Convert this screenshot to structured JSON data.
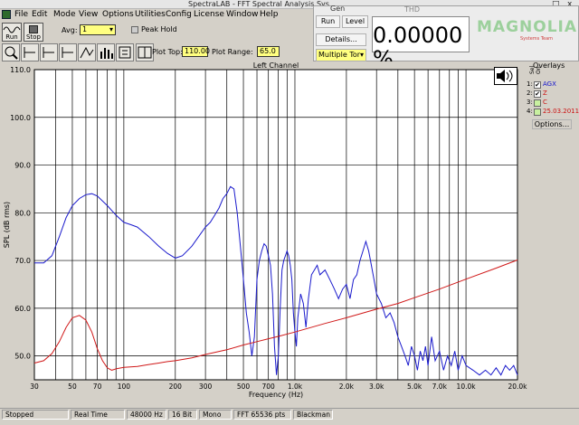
{
  "window": {
    "title": "SpectraLAB - FFT Spectral Analysis Sys",
    "controls": {
      "minimize": "_",
      "maximize": "□",
      "close": "x"
    }
  },
  "menu": [
    "File",
    "Edit",
    "Mode",
    "View",
    "Options",
    "Utilities",
    "Config",
    "License",
    "Window",
    "Help"
  ],
  "toolbar": {
    "run_label": "Run",
    "stop_label": "Stop",
    "avg_label": "Avg:",
    "avg_value": "1",
    "peak_hold_label": "Peak Hold",
    "plot_top_label": "Plot Top:",
    "plot_top_value": "110.00",
    "plot_range_label": "Plot Range:",
    "plot_range_value": "65.0"
  },
  "thd_panel": {
    "tab_label": "Gen",
    "title": "THD",
    "run_label": "Run",
    "level_label": "Level",
    "details_label": "Details...",
    "mode_value": "Multiple Tor",
    "reading": "0.00000 %",
    "logo": "MAGNOLIA",
    "logo_sub": "Systems Team"
  },
  "overlays": {
    "title": "Overlays",
    "col_sel": "Sel",
    "col_on": "On",
    "items": [
      {
        "index": "1:",
        "name": "AGX",
        "color": "#1010cc",
        "checked": true
      },
      {
        "index": "2:",
        "name": "Z",
        "color": "#cc1010",
        "checked": true
      },
      {
        "index": "3:",
        "name": "C",
        "color": "#cc1010",
        "checked": false
      },
      {
        "index": "4:",
        "name": "25.03.2011",
        "color": "#cc1010",
        "checked": false
      }
    ],
    "options_label": "Options..."
  },
  "chart_data": {
    "type": "line",
    "title": "Left Channel",
    "xlabel": "Frequency (Hz)",
    "ylabel": "SPL (dB rms)",
    "x_scale": "log",
    "xlim": [
      30,
      20000
    ],
    "ylim": [
      45,
      110
    ],
    "y_ticks": [
      50.0,
      60.0,
      70.0,
      80.0,
      90.0,
      100.0,
      110.0
    ],
    "x_ticks": [
      {
        "v": 30,
        "label": "30"
      },
      {
        "v": 50,
        "label": "50"
      },
      {
        "v": 70,
        "label": "70"
      },
      {
        "v": 100,
        "label": "100"
      },
      {
        "v": 200,
        "label": "200"
      },
      {
        "v": 300,
        "label": "300"
      },
      {
        "v": 500,
        "label": "500"
      },
      {
        "v": 700,
        "label": "700"
      },
      {
        "v": 1000,
        "label": "1.0k"
      },
      {
        "v": 2000,
        "label": "2.0k"
      },
      {
        "v": 3000,
        "label": "3.0k"
      },
      {
        "v": 5000,
        "label": "5.0k"
      },
      {
        "v": 7000,
        "label": "7.0k"
      },
      {
        "v": 10000,
        "label": "10.0k"
      },
      {
        "v": 20000,
        "label": "20.0k"
      }
    ],
    "grid": true,
    "series": [
      {
        "name": "AGX",
        "color": "#1a1acc",
        "points": [
          [
            30,
            69.5
          ],
          [
            34,
            69.5
          ],
          [
            38,
            71
          ],
          [
            42,
            75
          ],
          [
            46,
            79
          ],
          [
            50,
            81.5
          ],
          [
            55,
            83
          ],
          [
            60,
            83.8
          ],
          [
            65,
            84
          ],
          [
            70,
            83.5
          ],
          [
            80,
            81.5
          ],
          [
            90,
            79.5
          ],
          [
            100,
            78
          ],
          [
            110,
            77.5
          ],
          [
            120,
            77
          ],
          [
            140,
            75
          ],
          [
            160,
            73
          ],
          [
            180,
            71.5
          ],
          [
            200,
            70.5
          ],
          [
            220,
            71
          ],
          [
            250,
            73
          ],
          [
            280,
            75.5
          ],
          [
            300,
            77
          ],
          [
            320,
            78
          ],
          [
            340,
            79.5
          ],
          [
            360,
            81
          ],
          [
            380,
            83
          ],
          [
            400,
            84
          ],
          [
            420,
            85.5
          ],
          [
            440,
            85
          ],
          [
            460,
            80
          ],
          [
            480,
            73
          ],
          [
            500,
            66
          ],
          [
            520,
            59
          ],
          [
            540,
            55
          ],
          [
            560,
            50
          ],
          [
            580,
            54
          ],
          [
            600,
            66
          ],
          [
            620,
            70
          ],
          [
            640,
            72
          ],
          [
            660,
            73.5
          ],
          [
            680,
            73
          ],
          [
            700,
            71
          ],
          [
            720,
            69
          ],
          [
            740,
            63
          ],
          [
            760,
            52
          ],
          [
            780,
            46
          ],
          [
            800,
            50
          ],
          [
            820,
            60
          ],
          [
            840,
            68
          ],
          [
            860,
            70
          ],
          [
            880,
            71
          ],
          [
            900,
            72
          ],
          [
            920,
            71
          ],
          [
            940,
            69
          ],
          [
            960,
            66
          ],
          [
            980,
            59
          ],
          [
            1000,
            55
          ],
          [
            1020,
            52
          ],
          [
            1040,
            58
          ],
          [
            1080,
            63
          ],
          [
            1120,
            61
          ],
          [
            1160,
            56
          ],
          [
            1200,
            62
          ],
          [
            1250,
            67
          ],
          [
            1300,
            68
          ],
          [
            1350,
            69
          ],
          [
            1400,
            67
          ],
          [
            1500,
            68
          ],
          [
            1600,
            66
          ],
          [
            1700,
            64
          ],
          [
            1800,
            62
          ],
          [
            1900,
            64
          ],
          [
            2000,
            65
          ],
          [
            2100,
            62
          ],
          [
            2200,
            66
          ],
          [
            2300,
            67
          ],
          [
            2400,
            70
          ],
          [
            2500,
            72
          ],
          [
            2600,
            74
          ],
          [
            2700,
            72
          ],
          [
            2800,
            69
          ],
          [
            2900,
            66
          ],
          [
            3000,
            63
          ],
          [
            3200,
            61
          ],
          [
            3400,
            58
          ],
          [
            3600,
            59
          ],
          [
            3800,
            57
          ],
          [
            4000,
            54
          ],
          [
            4200,
            52
          ],
          [
            4400,
            50
          ],
          [
            4600,
            48
          ],
          [
            4800,
            52
          ],
          [
            5000,
            50
          ],
          [
            5200,
            47
          ],
          [
            5400,
            51
          ],
          [
            5600,
            49
          ],
          [
            5800,
            52
          ],
          [
            6000,
            48
          ],
          [
            6300,
            54
          ],
          [
            6600,
            49
          ],
          [
            7000,
            51
          ],
          [
            7400,
            47
          ],
          [
            7800,
            50
          ],
          [
            8200,
            48
          ],
          [
            8600,
            51
          ],
          [
            9000,
            47
          ],
          [
            9500,
            50
          ],
          [
            10000,
            48
          ],
          [
            11000,
            47
          ],
          [
            12000,
            46
          ],
          [
            13000,
            47
          ],
          [
            14000,
            46
          ],
          [
            15000,
            47.5
          ],
          [
            16000,
            46
          ],
          [
            17000,
            48
          ],
          [
            18000,
            47
          ],
          [
            19000,
            48
          ],
          [
            20000,
            46
          ]
        ]
      },
      {
        "name": "Z",
        "color": "#d01818",
        "points": [
          [
            30,
            48.5
          ],
          [
            34,
            49
          ],
          [
            38,
            50.5
          ],
          [
            42,
            53
          ],
          [
            46,
            56
          ],
          [
            50,
            58
          ],
          [
            55,
            58.5
          ],
          [
            60,
            57.5
          ],
          [
            65,
            55
          ],
          [
            70,
            51.5
          ],
          [
            75,
            49
          ],
          [
            80,
            47.5
          ],
          [
            85,
            47
          ],
          [
            90,
            47.3
          ],
          [
            100,
            47.6
          ],
          [
            120,
            47.8
          ],
          [
            140,
            48.2
          ],
          [
            160,
            48.5
          ],
          [
            180,
            48.8
          ],
          [
            200,
            49
          ],
          [
            250,
            49.6
          ],
          [
            300,
            50.3
          ],
          [
            400,
            51.3
          ],
          [
            500,
            52.3
          ],
          [
            600,
            53
          ],
          [
            700,
            53.6
          ],
          [
            800,
            54.1
          ],
          [
            1000,
            55
          ],
          [
            1500,
            56.8
          ],
          [
            2000,
            58
          ],
          [
            3000,
            59.8
          ],
          [
            4000,
            61
          ],
          [
            5000,
            62.2
          ],
          [
            7000,
            64
          ],
          [
            10000,
            66.1
          ],
          [
            15000,
            68.4
          ],
          [
            20000,
            70.1
          ]
        ]
      }
    ]
  },
  "status": {
    "state": "Stopped",
    "mode": "Real Time",
    "rate": "48000 Hz",
    "bits": "16 Bit",
    "channels": "Mono",
    "fft": "FFT 65536 pts",
    "window": "Blackman"
  }
}
